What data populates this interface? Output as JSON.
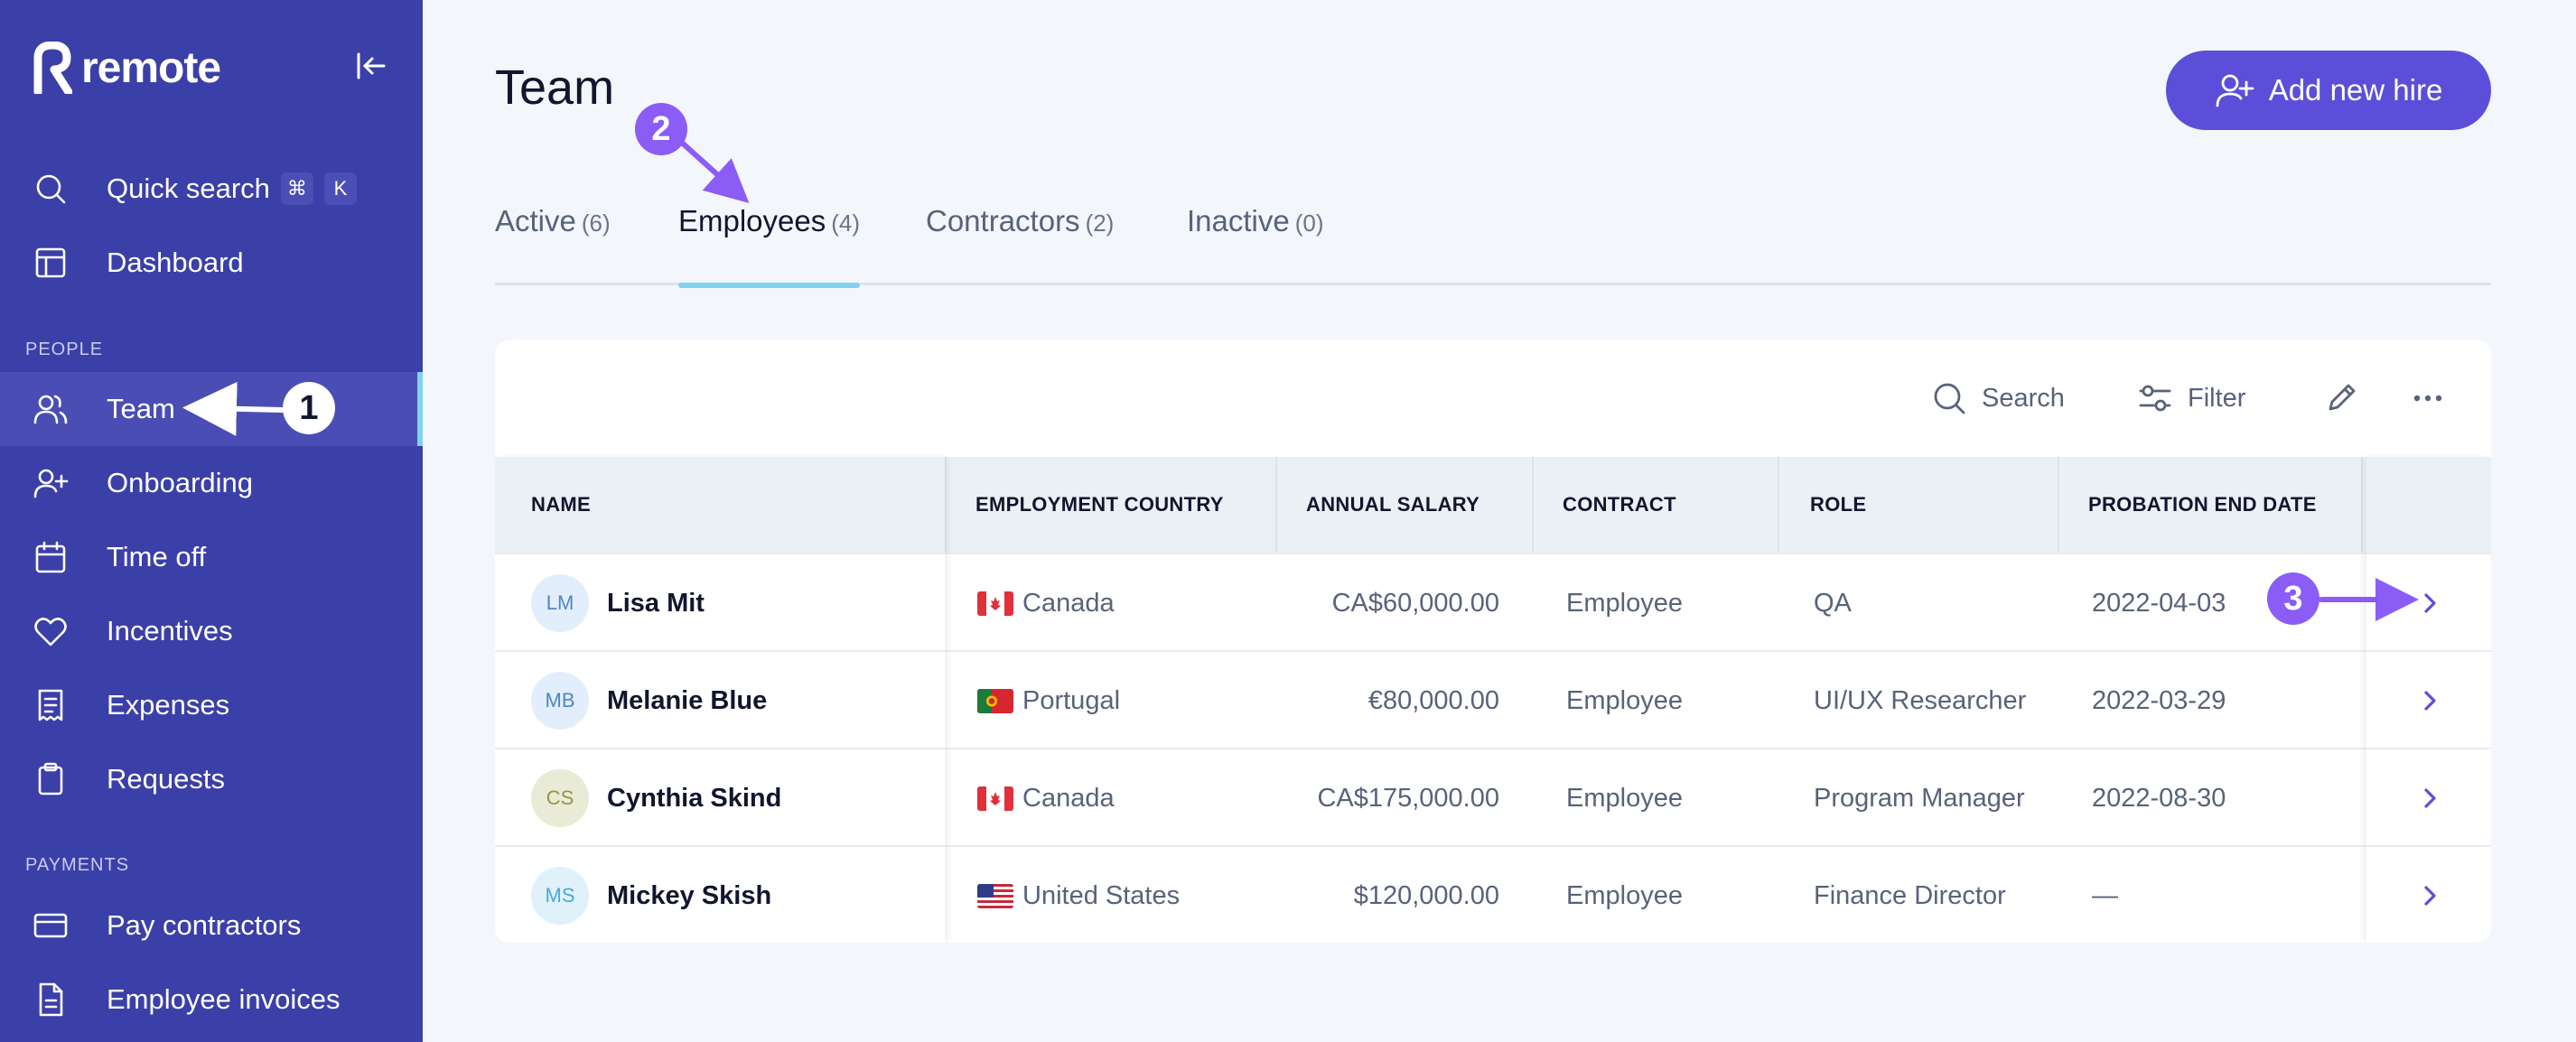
{
  "brand": {
    "name": "remote"
  },
  "sidebar": {
    "quick_search": {
      "label": "Quick search",
      "keys": [
        "⌘",
        "K"
      ]
    },
    "dashboard": "Dashboard",
    "people_section": "PEOPLE",
    "people_items": [
      {
        "label": "Team",
        "icon": "users-icon"
      },
      {
        "label": "Onboarding",
        "icon": "user-plus-icon"
      },
      {
        "label": "Time off",
        "icon": "calendar-icon"
      },
      {
        "label": "Incentives",
        "icon": "heart-icon"
      },
      {
        "label": "Expenses",
        "icon": "receipt-icon"
      },
      {
        "label": "Requests",
        "icon": "clipboard-icon"
      }
    ],
    "payments_section": "PAYMENTS",
    "payments_items": [
      {
        "label": "Pay contractors",
        "icon": "card-icon"
      },
      {
        "label": "Employee invoices",
        "icon": "invoice-icon"
      }
    ],
    "active_item": "Team"
  },
  "header": {
    "title": "Team",
    "add_button": "Add new hire"
  },
  "tabs": [
    {
      "label": "Active",
      "count": "(6)"
    },
    {
      "label": "Employees",
      "count": "(4)"
    },
    {
      "label": "Contractors",
      "count": "(2)"
    },
    {
      "label": "Inactive",
      "count": "(0)"
    }
  ],
  "active_tab": "Employees",
  "toolbar": {
    "search": "Search",
    "filter": "Filter"
  },
  "table": {
    "columns": [
      "NAME",
      "EMPLOYMENT COUNTRY",
      "ANNUAL SALARY",
      "CONTRACT",
      "ROLE",
      "PROBATION END DATE"
    ],
    "rows": [
      {
        "initials": "LM",
        "name": "Lisa Mit",
        "country": "Canada",
        "flag": "ca",
        "salary": "CA$60,000.00",
        "contract": "Employee",
        "role": "QA",
        "probation": "2022-04-03"
      },
      {
        "initials": "MB",
        "name": "Melanie Blue",
        "country": "Portugal",
        "flag": "pt",
        "salary": "€80,000.00",
        "contract": "Employee",
        "role": "UI/UX Researcher",
        "probation": "2022-03-29"
      },
      {
        "initials": "CS",
        "name": "Cynthia Skind",
        "country": "Canada",
        "flag": "ca",
        "salary": "CA$175,000.00",
        "contract": "Employee",
        "role": "Program Manager",
        "probation": "2022-08-30"
      },
      {
        "initials": "MS",
        "name": "Mickey Skish",
        "country": "United States",
        "flag": "us",
        "salary": "$120,000.00",
        "contract": "Employee",
        "role": "Finance Director",
        "probation": "—"
      }
    ]
  },
  "colors": {
    "sidebar_bg": "#3b3fa8",
    "accent": "#5b4fd9",
    "tab_underline": "#7fd3ee",
    "annotation": "#8b5cf6"
  },
  "annotations": [
    "1",
    "2",
    "3"
  ]
}
